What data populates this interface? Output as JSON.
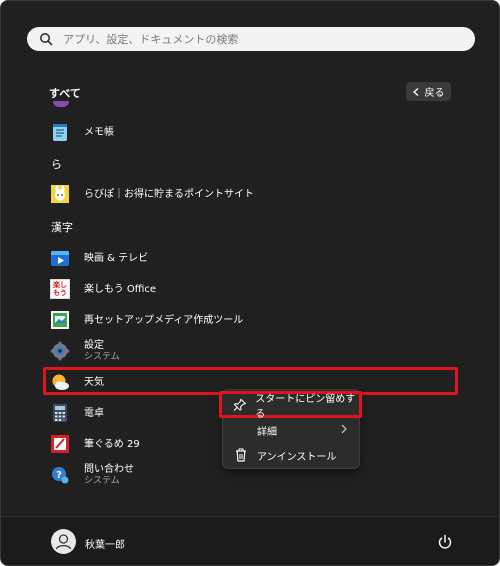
{
  "search": {
    "placeholder": "アプリ、設定、ドキュメントの検索"
  },
  "header": {
    "title": "すべて",
    "back_label": "戻る"
  },
  "apps": [
    {
      "name": "メモ帳",
      "sub": "",
      "icon": "notepad-icon"
    },
    {
      "name": "らびぽ｜お得に貯まるポイントサイト",
      "sub": "",
      "icon": "rabipo-icon"
    },
    {
      "name": "映画 & テレビ",
      "sub": "",
      "icon": "movies-tv-icon"
    },
    {
      "name": "楽しもう Office",
      "sub": "",
      "icon": "office-icon"
    },
    {
      "name": "再セットアップメディア作成ツール",
      "sub": "",
      "icon": "recovery-media-icon"
    },
    {
      "name": "設定",
      "sub": "システム",
      "icon": "settings-gear-icon"
    },
    {
      "name": "天気",
      "sub": "",
      "icon": "weather-icon"
    },
    {
      "name": "電卓",
      "sub": "",
      "icon": "calculator-icon"
    },
    {
      "name": "筆ぐるめ 29",
      "sub": "",
      "icon": "fudegurume-icon"
    },
    {
      "name": "問い合わせ",
      "sub": "システム",
      "icon": "contact-support-icon"
    }
  ],
  "letters": {
    "ra": "ら",
    "kanji": "漢字"
  },
  "context_menu": {
    "pin_label": "スタートにピン留めする",
    "details_label": "詳細",
    "uninstall_label": "アンインストール"
  },
  "office_icon_text": {
    "line1": "楽し",
    "line2": "もう"
  },
  "user": {
    "name": "秋葉一郎"
  },
  "colors": {
    "highlight": "#e0141e",
    "background": "#202020"
  }
}
